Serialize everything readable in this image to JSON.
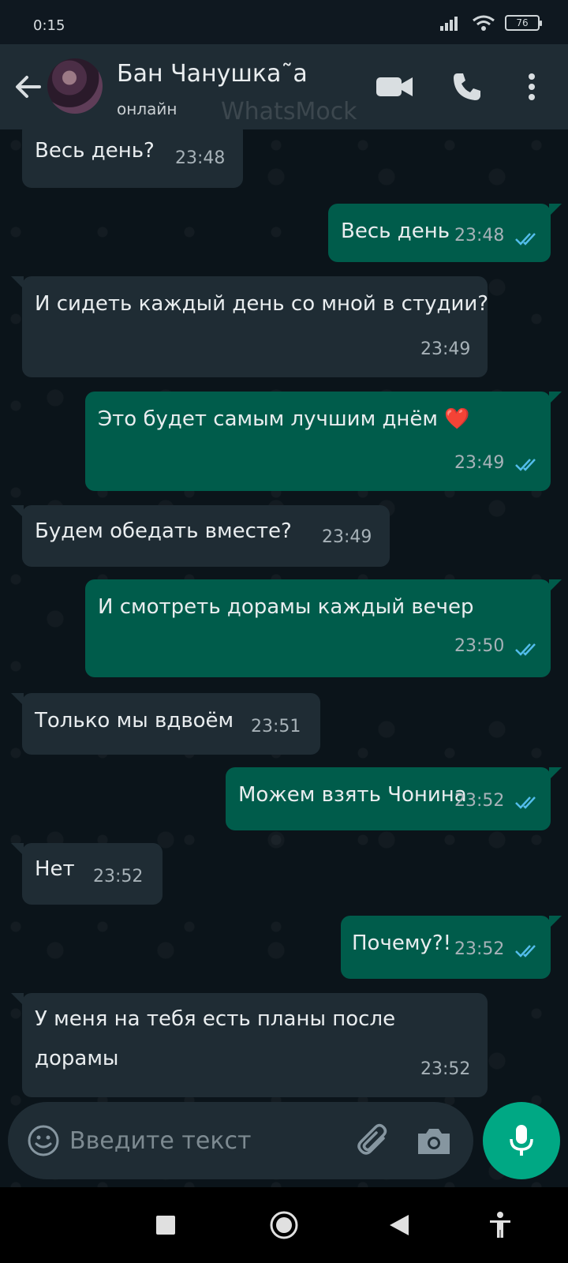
{
  "status_bar": {
    "time": "0:15",
    "battery": "76"
  },
  "header": {
    "contact_name": "Бан Чанушка˜а",
    "contact_status": "онлайн",
    "watermark": "WhatsMock"
  },
  "messages": [
    {
      "direction": "in",
      "text": "Весь день?",
      "time": "23:48"
    },
    {
      "direction": "out",
      "text": "Весь день",
      "time": "23:48",
      "read": true
    },
    {
      "direction": "in",
      "text": "И сидеть каждый день со мной в студии?",
      "time": "23:49"
    },
    {
      "direction": "out",
      "text": "Это будет самым лучшим днём ❤️",
      "time": "23:49",
      "read": true
    },
    {
      "direction": "in",
      "text": "Будем обедать вместе?",
      "time": "23:49"
    },
    {
      "direction": "out",
      "text": "И смотреть дорамы каждый вечер",
      "time": "23:50",
      "read": true
    },
    {
      "direction": "in",
      "text": "Только мы вдвоём",
      "time": "23:51"
    },
    {
      "direction": "out",
      "text": "Можем взять Чонина",
      "time": "23:52",
      "read": true
    },
    {
      "direction": "in",
      "text": "Нет",
      "time": "23:52"
    },
    {
      "direction": "out",
      "text": "Почему?!",
      "time": "23:52",
      "read": true
    },
    {
      "direction": "in",
      "lines": [
        "У меня на тебя есть планы после",
        "дорамы"
      ],
      "time": "23:52"
    }
  ],
  "composer": {
    "placeholder": "Введите текст"
  },
  "icons": {
    "back": "arrow-left-icon",
    "video": "video-camera-icon",
    "call": "phone-icon",
    "menu": "more-vert-icon",
    "emoji": "emoji-icon",
    "attach": "paperclip-icon",
    "camera": "camera-icon",
    "mic": "microphone-icon",
    "nav_recents": "square-icon",
    "nav_home": "circle-icon",
    "nav_back": "triangle-back-icon",
    "nav_accessibility": "accessibility-icon"
  },
  "colors": {
    "incoming_bubble": "#1f2c34",
    "outgoing_bubble": "#005c4b",
    "read_tick": "#53bdeb",
    "mic_button": "#00a884",
    "background": "#0b141a"
  }
}
